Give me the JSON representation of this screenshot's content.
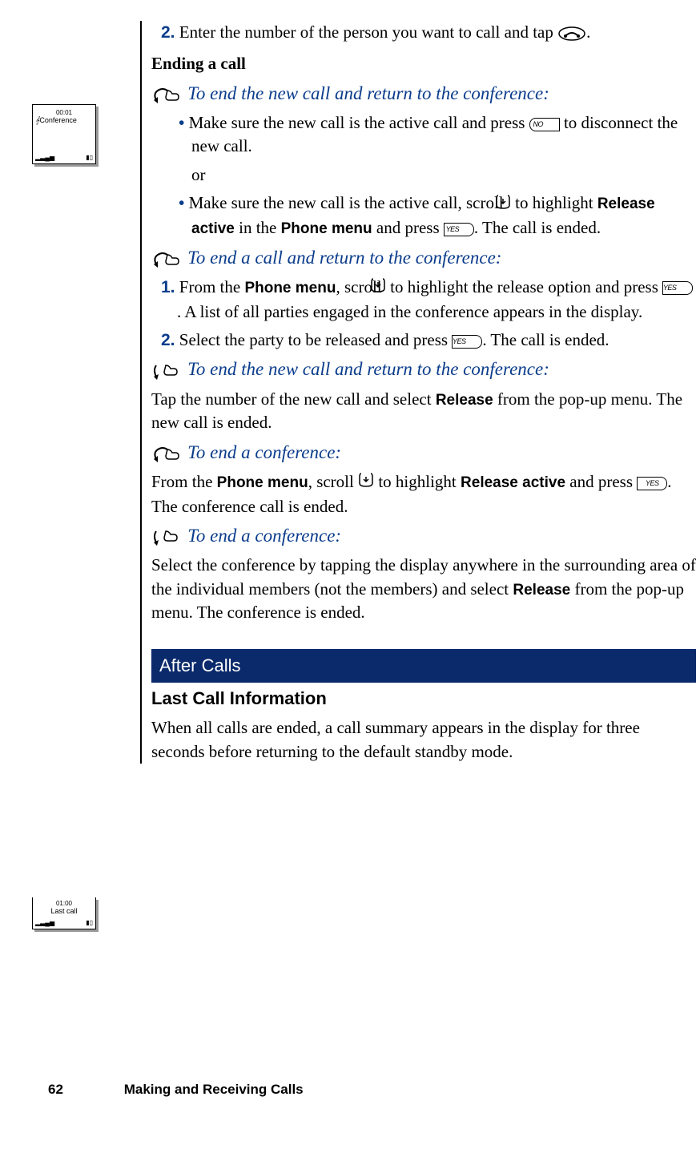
{
  "sidebar1": {
    "time": "00:01",
    "label": "Conference",
    "signal": "▂▃▄▅",
    "battery": "▮▯"
  },
  "sidebar2": {
    "time": "01:00",
    "label": "Last call",
    "signal": "▂▃▄▅",
    "battery": "▮▯"
  },
  "step2_text": "Enter the number of the person you want to call and tap ",
  "step2_num": "2.",
  "period": ".",
  "ending_head": "Ending a call",
  "h_end_new_conf": "To end the new call and return to the conference:",
  "b1_text_pre": "Make sure the new call is the active call and press ",
  "b1_text_post": " to disconnect the new call.",
  "or_text": "or",
  "b2_text_pre": "Make sure the new call is the active call, scroll ",
  "b2_text_mid": " to highlight ",
  "b2_bold1": "Release active",
  "b2_text_mid2": " in the ",
  "b2_bold2": "Phone menu",
  "b2_text_post": " and press ",
  "b2_end": ". The call is ended.",
  "h_end_call_conf": "To end a call and return to the conference:",
  "s1_num": "1.",
  "s1_pre": "From the ",
  "s1_bold": "Phone menu",
  "s1_mid": ", scroll ",
  "s1_mid2": " to highlight the release option and press ",
  "s1_post": ". A list of all parties engaged in the conference appears in the display.",
  "s2_num": "2.",
  "s2_pre": "Select the party to be released and press ",
  "s2_post": ". The call is ended.",
  "p_tap_pre": "Tap the number of the new call and select ",
  "p_tap_bold": "Release",
  "p_tap_post": " from the pop-up menu. The new call is ended.",
  "h_end_conf": "To end a conference:",
  "p_conf1_pre": "From the ",
  "p_conf1_bold1": "Phone menu",
  "p_conf1_mid": ", scroll ",
  "p_conf1_mid2": " to highlight ",
  "p_conf1_bold2": "Release active",
  "p_conf1_mid3": " and press ",
  "p_conf1_post": ". The conference call is ended.",
  "p_conf2_pre": "Select the conference by tapping the display anywhere in the surrounding area of the individual members (not the members) and select ",
  "p_conf2_bold": "Release",
  "p_conf2_post": " from the pop-up menu. The conference is ended.",
  "section_bar": "After Calls",
  "h3_last": "Last Call Information",
  "p_last": "When all calls are ended, a call summary appears in the display for three seconds before returning to the default standby mode.",
  "btn_no": "NO",
  "btn_yes": "YES",
  "footer_page": "62",
  "footer_title": "Making and Receiving Calls"
}
